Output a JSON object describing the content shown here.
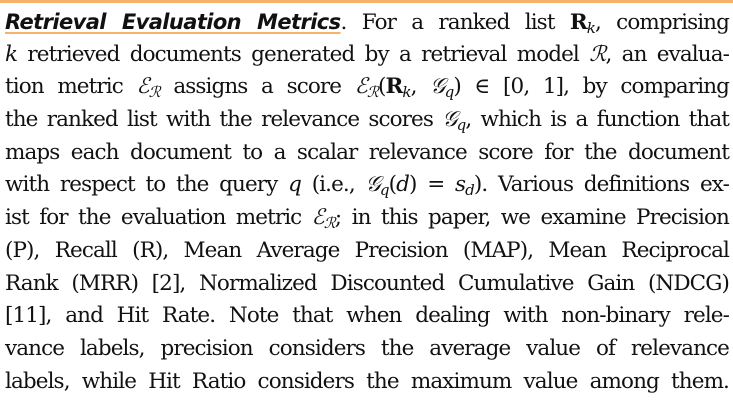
{
  "heading": "Retrieval Evaluation Metrics",
  "lines": [
    [
      {
        "k": "heading",
        "t": "Retrieval Evaluation Metrics"
      },
      {
        "t": ". For a ranked list "
      },
      {
        "k": "bold",
        "t": "R"
      },
      {
        "k": "sub",
        "t": "k"
      },
      {
        "t": ", comprising"
      }
    ],
    [
      {
        "k": "italic",
        "t": "k"
      },
      {
        "t": " retrieved documents generated by a retrieval model "
      },
      {
        "k": "script",
        "t": "ℛ"
      },
      {
        "t": ", an evalua-"
      }
    ],
    [
      {
        "t": "tion metric "
      },
      {
        "k": "script",
        "t": "ℰ"
      },
      {
        "k": "sub",
        "t": "ℛ"
      },
      {
        "t": " assigns a score "
      },
      {
        "k": "script",
        "t": "ℰ"
      },
      {
        "k": "sub",
        "t": "ℛ"
      },
      {
        "t": "("
      },
      {
        "k": "bold",
        "t": "R"
      },
      {
        "k": "sub",
        "t": "k"
      },
      {
        "t": ", "
      },
      {
        "k": "script",
        "t": "𝒢"
      },
      {
        "k": "sub",
        "t": "q"
      },
      {
        "t": ") ∈ [0, 1], by comparing"
      }
    ],
    [
      {
        "t": "the ranked list with the relevance scores "
      },
      {
        "k": "script",
        "t": "𝒢"
      },
      {
        "k": "sub",
        "t": "q"
      },
      {
        "t": ", which is a function that"
      }
    ],
    [
      {
        "t": "maps each document to a scalar relevance score for the document"
      }
    ],
    [
      {
        "t": "with respect to the query "
      },
      {
        "k": "italic",
        "t": "q"
      },
      {
        "t": " (i.e., "
      },
      {
        "k": "script",
        "t": "𝒢"
      },
      {
        "k": "sub",
        "t": "q"
      },
      {
        "t": "("
      },
      {
        "k": "italic",
        "t": "d"
      },
      {
        "t": ") = "
      },
      {
        "k": "italic",
        "t": "s"
      },
      {
        "k": "sub",
        "t": "d"
      },
      {
        "t": "). Various definitions ex-"
      }
    ],
    [
      {
        "t": "ist for the evaluation metric "
      },
      {
        "k": "script",
        "t": "ℰ"
      },
      {
        "k": "sub",
        "t": "ℛ"
      },
      {
        "t": "; in this paper, we examine Precision"
      }
    ],
    [
      {
        "t": "(P), Recall (R), Mean Average Precision (MAP), Mean Reciprocal"
      }
    ],
    [
      {
        "t": "Rank (MRR) [2], Normalized Discounted Cumulative Gain (NDCG)"
      }
    ],
    [
      {
        "t": "[11], and Hit Rate. Note that when dealing with non-binary rele-"
      }
    ],
    [
      {
        "t": "vance labels, precision considers the average value of relevance"
      }
    ],
    [
      {
        "t": "labels, while Hit Ratio considers the maximum value among them."
      }
    ]
  ],
  "colors": {
    "accent": "#f6b26b",
    "text": "#111111"
  }
}
